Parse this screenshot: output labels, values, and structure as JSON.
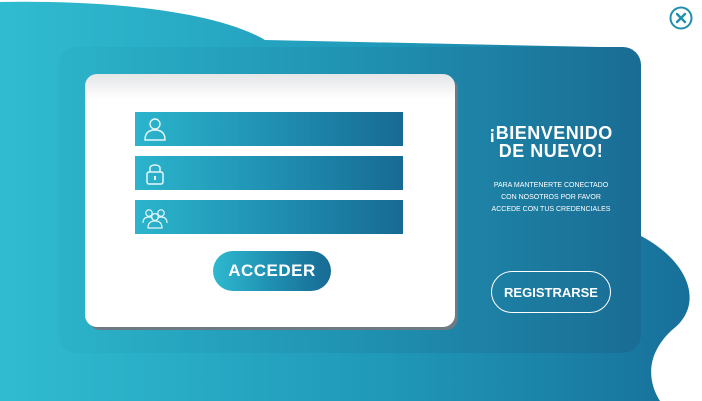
{
  "close": {
    "icon": "close-icon"
  },
  "login_form": {
    "fields": [
      {
        "icon": "user-icon",
        "value": ""
      },
      {
        "icon": "lock-icon",
        "value": ""
      },
      {
        "icon": "group-icon",
        "value": ""
      }
    ],
    "submit_label": "ACCEDER"
  },
  "welcome_panel": {
    "title_line1": "¡BIENVENIDO",
    "title_line2": "DE NUEVO!",
    "message_lines": [
      "PARA MANTENERTE CONECTADO",
      "CON NOSOTROS POR FAVOR",
      "ACCEDE CON TUS CREDENCIALES"
    ],
    "register_label": "REGISTRARSE"
  },
  "colors": {
    "accent_light": "#2bb3c9",
    "accent_dark": "#176a93",
    "close_icon": "#1f8fb0"
  }
}
